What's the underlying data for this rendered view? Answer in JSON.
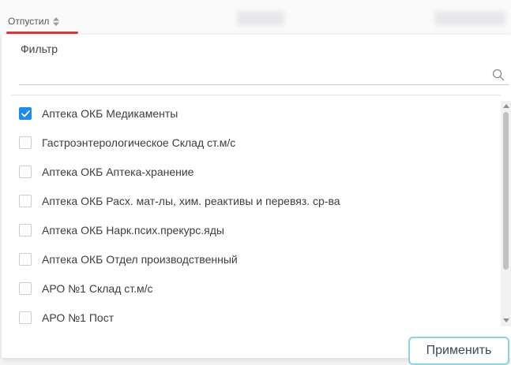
{
  "header": {
    "column_title": "Отпустил"
  },
  "filter": {
    "label": "Фильтр",
    "value": "",
    "placeholder": ""
  },
  "items": [
    {
      "label": "Аптека ОКБ Медикаменты",
      "checked": true
    },
    {
      "label": "Гастроэнтерологическое Склад ст.м/с",
      "checked": false
    },
    {
      "label": "Аптека ОКБ Аптека-хранение",
      "checked": false
    },
    {
      "label": "Аптека ОКБ Расх. мат-лы, хим. реактивы и перевяз. ср-ва",
      "checked": false
    },
    {
      "label": "Аптека ОКБ Нарк.псих.прекурс.яды",
      "checked": false
    },
    {
      "label": "Аптека ОКБ Отдел производственный",
      "checked": false
    },
    {
      "label": "АРО №1 Склад ст.м/с",
      "checked": false
    },
    {
      "label": "АРО №1 Пост",
      "checked": false
    }
  ],
  "apply_label": "Применить",
  "colors": {
    "accent_underline": "#d93a3a",
    "checkbox_checked": "#1e8ce8",
    "button_border": "#8fd3e0"
  }
}
